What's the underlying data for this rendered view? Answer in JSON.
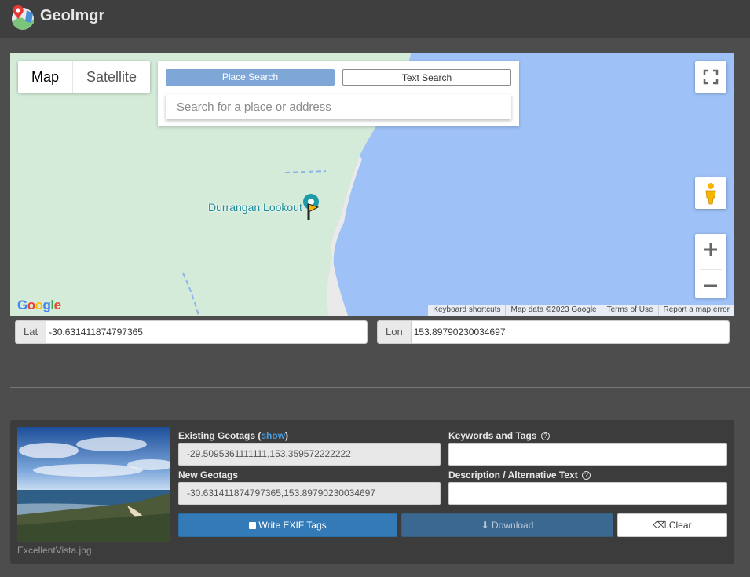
{
  "app": {
    "title": "GeoImgr"
  },
  "map": {
    "type_buttons": {
      "map": "Map",
      "satellite": "Satellite"
    },
    "search": {
      "place_label": "Place Search",
      "text_label": "Text Search",
      "placeholder": "Search for a place or address"
    },
    "poi_label": "Durrangan Lookout",
    "google_logo": "Google",
    "attribution": {
      "shortcuts": "Keyboard shortcuts",
      "data": "Map data ©2023 Google",
      "terms": "Terms of Use",
      "report": "Report a map error"
    }
  },
  "coords": {
    "lat_label": "Lat",
    "lat_value": "-30.631411874797365",
    "lon_label": "Lon",
    "lon_value": "153.89790230034697"
  },
  "image": {
    "filename": "ExcellentVista.jpg"
  },
  "geotags": {
    "existing_label": "Existing Geotags (",
    "show_link": "show",
    "existing_close": ")",
    "existing_value": "-29.5095361111111,153.359572222222",
    "new_label": "New Geotags",
    "new_value": "-30.631411874797365,153.89790230034697"
  },
  "meta": {
    "keywords_label": "Keywords and Tags",
    "description_label": "Description / Alternative Text"
  },
  "actions": {
    "write_label": "Write EXIF Tags",
    "download_label": "Download",
    "clear_label": "Clear"
  },
  "colors": {
    "water": "#9ec1f7",
    "land": "#d4ebd9",
    "primary": "#337ab7"
  }
}
